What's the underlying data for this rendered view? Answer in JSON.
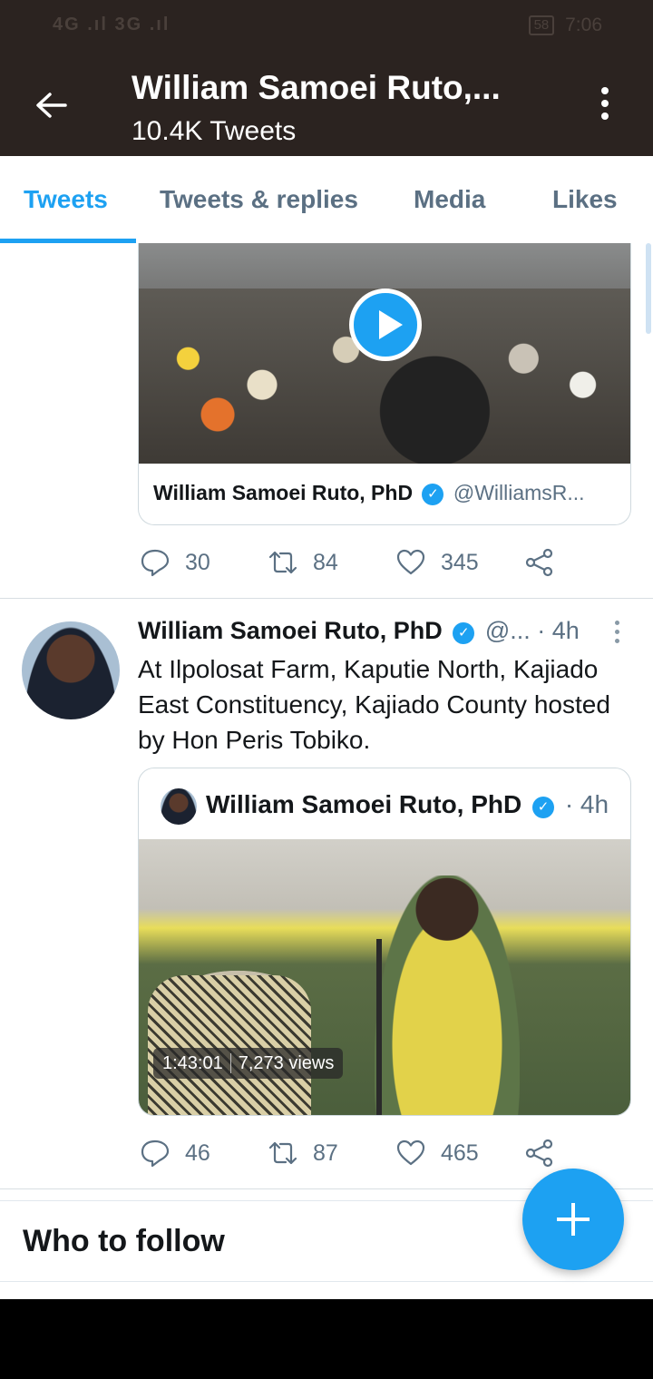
{
  "status_bar": {
    "left_icons": "4G .ıl 3G .ıl",
    "battery": "58",
    "time": "7:06"
  },
  "header": {
    "title": "William Samoei Ruto,...",
    "subtitle": "10.4K Tweets"
  },
  "tabs": [
    {
      "label": "Tweets",
      "active": true
    },
    {
      "label": "Tweets & replies",
      "active": false
    },
    {
      "label": "Media",
      "active": false
    },
    {
      "label": "Likes",
      "active": false
    }
  ],
  "tweet1": {
    "card_name": "William Samoei Ruto, PhD",
    "card_handle": "@WilliamsR...",
    "replies": "30",
    "retweets": "84",
    "likes": "345"
  },
  "tweet2": {
    "name": "William Samoei Ruto, PhD",
    "handle": "@...",
    "time": "· 4h",
    "text": "At Ilpolosat Farm, Kaputie North, Kajiado East Constituency, Kajiado County hosted by Hon Peris Tobiko.",
    "quoted": {
      "name": "William Samoei Ruto, PhD",
      "time": "· 4h",
      "duration": "1:43:01",
      "views": "7,273 views"
    },
    "replies": "46",
    "retweets": "87",
    "likes": "465"
  },
  "who_to_follow": {
    "title": "Who to follow"
  },
  "colors": {
    "header_bg": "#2b2320",
    "accent": "#1da1f2",
    "secondary_text": "#5b7083"
  }
}
